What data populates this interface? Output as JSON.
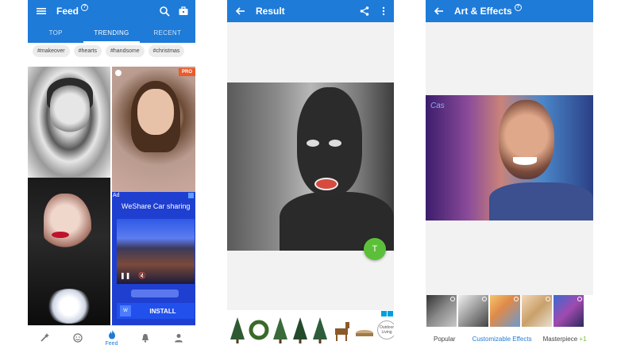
{
  "feed_screen": {
    "title": "Feed",
    "tabs": [
      {
        "label": "TOP"
      },
      {
        "label": "TRENDING"
      },
      {
        "label": "RECENT"
      }
    ],
    "hashtags": [
      "#makeover",
      "#hearts",
      "#handsome",
      "#christmas"
    ],
    "pro_badge": "PRO",
    "ad": {
      "tag": "Ad",
      "title": "WeShare Car sharing",
      "install_label": "INSTALL"
    },
    "bottom_nav": [
      {
        "icon": "magic-wand-icon",
        "label": ""
      },
      {
        "icon": "smiley-icon",
        "label": ""
      },
      {
        "icon": "flame-icon",
        "label": "Feed"
      },
      {
        "icon": "bell-icon",
        "label": ""
      },
      {
        "icon": "person-icon",
        "label": ""
      }
    ]
  },
  "result_screen": {
    "title": "Result",
    "fab_label": "T",
    "ad_brand": "Outdoor Living"
  },
  "effects_screen": {
    "title": "Art & Effects",
    "signature": "Cas",
    "filters": [
      {
        "label": "Popular"
      },
      {
        "label": "Customizable Effects"
      },
      {
        "label": "Masterpiece"
      }
    ],
    "masterpiece_badge": "+1"
  },
  "colors": {
    "appbar": "#1e7bd8",
    "accent_blue": "#1e7bd8",
    "fab_green": "#5cbf3a",
    "pro_orange": "#e95b2b",
    "ad_blue": "#1f3fd0"
  }
}
